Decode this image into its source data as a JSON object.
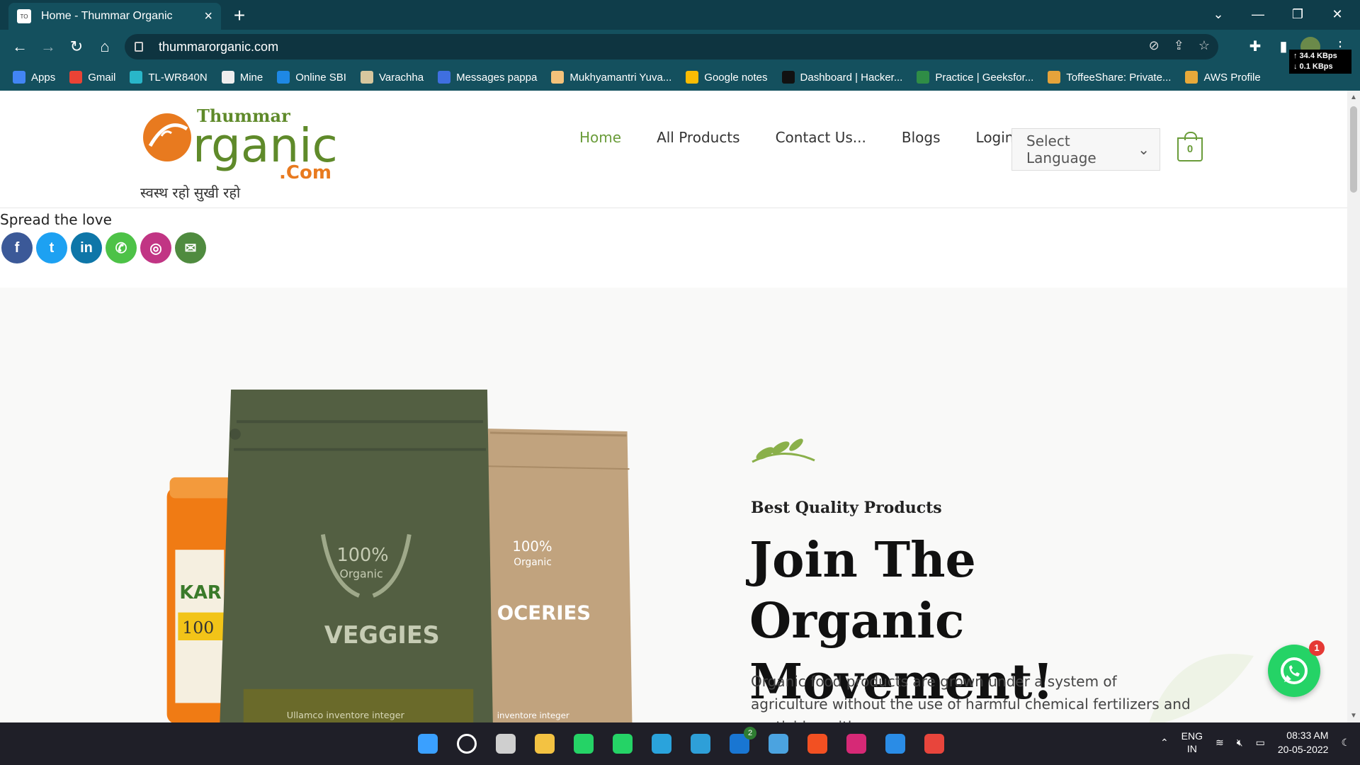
{
  "browser": {
    "tab_title": "Home - Thummar Organic",
    "tab_favicon": "TO",
    "url": "thummarorganic.com",
    "net_speed": [
      "↑ 34.4 KBps",
      "↓ 0.1 KBps"
    ],
    "bookmarks": [
      {
        "label": "Apps",
        "icon": "apps-grid-icon",
        "color": "#4285f4"
      },
      {
        "label": "Gmail",
        "icon": "gmail-icon",
        "color": "#ea4335"
      },
      {
        "label": "TL-WR840N",
        "icon": "router-icon",
        "color": "#29b6c9"
      },
      {
        "label": "Mine",
        "icon": "mine-icon",
        "color": "#eeeeee"
      },
      {
        "label": "Online SBI",
        "icon": "sbi-icon",
        "color": "#1e88e5"
      },
      {
        "label": "Varachha",
        "icon": "varachha-icon",
        "color": "#d7c79e"
      },
      {
        "label": "Messages pappa",
        "icon": "messages-icon",
        "color": "#3f6fe0"
      },
      {
        "label": "Mukhyamantri Yuva...",
        "icon": "yuva-icon",
        "color": "#f4c27a"
      },
      {
        "label": "Google notes",
        "icon": "keep-icon",
        "color": "#fbbc04"
      },
      {
        "label": "Dashboard | Hacker...",
        "icon": "hackerrank-icon",
        "color": "#111111"
      },
      {
        "label": "Practice | Geeksfor...",
        "icon": "gfg-icon",
        "color": "#2f8d46"
      },
      {
        "label": "ToffeeShare: Private...",
        "icon": "toffeeshare-icon",
        "color": "#e5a33b"
      },
      {
        "label": "AWS Profile",
        "icon": "aws-icon",
        "color": "#e8a93a"
      }
    ]
  },
  "site": {
    "logo": {
      "line1": "Thummar",
      "line2": "rganic",
      "line3": ".Com",
      "tagline": "स्वस्थ रहो सुखी रहो"
    },
    "nav": [
      {
        "label": "Home",
        "active": true
      },
      {
        "label": "All Products",
        "active": false
      },
      {
        "label": "Contact Us...",
        "active": false
      },
      {
        "label": "Blogs",
        "active": false
      },
      {
        "label": "Login",
        "active": false
      }
    ],
    "language_select": "Select Language",
    "cart_count": "0",
    "spread_label": "Spread the love",
    "share": [
      {
        "name": "facebook-share-icon",
        "glyph": "f",
        "color": "#3b5998"
      },
      {
        "name": "twitter-share-icon",
        "glyph": "t",
        "color": "#1da1f2"
      },
      {
        "name": "linkedin-share-icon",
        "glyph": "in",
        "color": "#0e76a8"
      },
      {
        "name": "whatsapp-share-icon",
        "glyph": "✆",
        "color": "#4dc247"
      },
      {
        "name": "instagram-share-icon",
        "glyph": "◎",
        "color": "#c13584"
      },
      {
        "name": "email-share-icon",
        "glyph": "✉",
        "color": "#4f8b3f"
      }
    ],
    "hero": {
      "subtitle": "Best Quality Products",
      "headline": "Join The Organic Movement!",
      "body": "Organic food products are grown under a system of agriculture without the use of harmful chemical fertilizers and pesticides with",
      "bag1_badge": "100%",
      "bag1_badge_sub": "Organic",
      "bag1_label": "VEGGIES",
      "bag2_badge": "100%",
      "bag2_badge_sub": "Organic",
      "bag2_label": "OCERIES",
      "jar_label": "100",
      "jar_brand": "KAR",
      "bag1_bottom": "Ullamco inventore integer",
      "bag2_bottom": "inventore integer"
    },
    "whatsapp_badge": "1"
  },
  "taskbar": {
    "icons": [
      {
        "name": "windows-start-icon",
        "color": "#3aa0ff"
      },
      {
        "name": "search-icon",
        "color": "#ffffff"
      },
      {
        "name": "task-view-icon",
        "color": "#cfcfcf"
      },
      {
        "name": "file-explorer-icon",
        "color": "#f3c242"
      },
      {
        "name": "whatsapp-icon",
        "color": "#25d366"
      },
      {
        "name": "whatsapp-desktop-icon",
        "color": "#25d366"
      },
      {
        "name": "telegram-icon",
        "color": "#2aa3dc"
      },
      {
        "name": "edge-icon",
        "color": "#2e9fd8"
      },
      {
        "name": "mail-icon",
        "color": "#1976d2"
      },
      {
        "name": "kodi-icon",
        "color": "#4ba3e0"
      },
      {
        "name": "microsoft-store-icon",
        "color": "#f25022"
      },
      {
        "name": "instagram-icon",
        "color": "#d62976"
      },
      {
        "name": "vscode-icon",
        "color": "#2a8ce6"
      },
      {
        "name": "chrome-icon",
        "color": "#e8453c"
      }
    ],
    "mail_badge": "2",
    "lang": [
      "ENG",
      "IN"
    ],
    "time": "08:33 AM",
    "date": "20-05-2022"
  }
}
